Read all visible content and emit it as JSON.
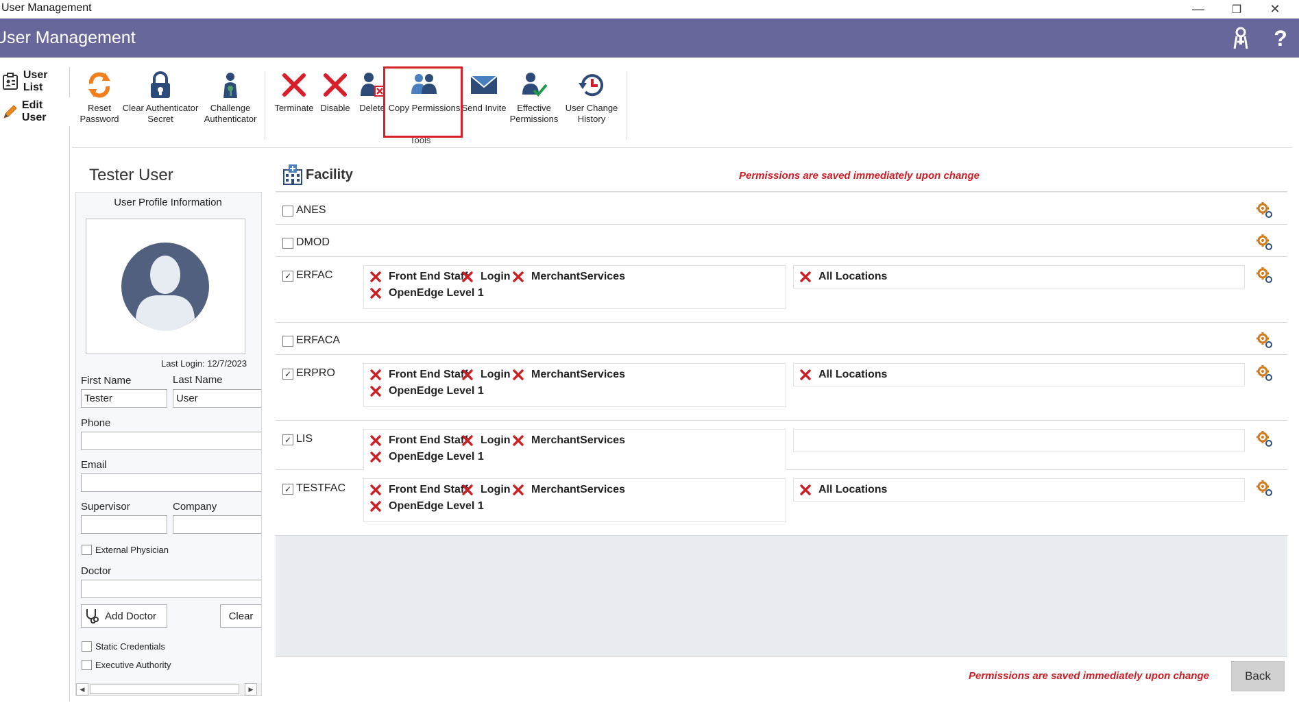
{
  "window": {
    "title": "User Management",
    "minimize_glyph": "—",
    "restore_glyph": "❐",
    "close_glyph": "✕"
  },
  "header": {
    "title": "User Management",
    "help_glyph": "?",
    "background": "#68679b"
  },
  "leftnav": {
    "items": [
      {
        "label": "User List",
        "icon": "user-list-icon"
      },
      {
        "label": "Edit User",
        "icon": "pencil-icon"
      }
    ]
  },
  "toolbar": {
    "group_label": "Tools",
    "buttons": [
      {
        "label": "Reset Password",
        "icon": "refresh-icon"
      },
      {
        "label": "Clear Authenticator Secret",
        "icon": "padlock-icon"
      },
      {
        "label": "Challenge Authenticator",
        "icon": "key-person-icon"
      },
      {
        "label": "Terminate",
        "icon": "red-x-icon"
      },
      {
        "label": "Disable",
        "icon": "red-x-icon"
      },
      {
        "label": "Delete",
        "icon": "user-delete-icon"
      },
      {
        "label": "Copy Permissions",
        "icon": "two-users-icon"
      },
      {
        "label": "Send Invite",
        "icon": "envelope-icon"
      },
      {
        "label": "Effective Permissions",
        "icon": "user-check-icon"
      },
      {
        "label": "User Change History",
        "icon": "history-clock-icon"
      }
    ]
  },
  "profile": {
    "display_name": "Tester User",
    "section_title": "User Profile Information",
    "last_login": "Last Login: 12/7/2023",
    "first_name_label": "First Name",
    "first_name": "Tester",
    "last_name_label": "Last Name",
    "last_name": "User",
    "phone_label": "Phone",
    "phone": "",
    "email_label": "Email",
    "email": "",
    "supervisor_label": "Supervisor",
    "supervisor": "",
    "company_label": "Company",
    "company": "",
    "external_physician_label": "External Physician",
    "doctor_label": "Doctor",
    "doctor": "",
    "add_doctor_label": "Add Doctor",
    "clear_label": "Clear",
    "static_credentials_label": "Static Credentials",
    "executive_authority_label": "Executive Authority"
  },
  "facility": {
    "title": "Facility",
    "notice": "Permissions are saved immediately upon change",
    "rows": [
      {
        "name": "ANES",
        "checked": false,
        "permissions": [],
        "locations": []
      },
      {
        "name": "DMOD",
        "checked": false,
        "permissions": [],
        "locations": []
      },
      {
        "name": "ERFAC",
        "checked": true,
        "permissions": [
          "Front End Staff",
          "Login",
          "MerchantServices",
          "OpenEdge Level 1"
        ],
        "locations": [
          "All Locations"
        ]
      },
      {
        "name": "ERFACA",
        "checked": false,
        "permissions": [],
        "locations": []
      },
      {
        "name": "ERPRO",
        "checked": true,
        "permissions": [
          "Front End Staff",
          "Login",
          "MerchantServices",
          "OpenEdge Level 1"
        ],
        "locations": [
          "All Locations"
        ]
      },
      {
        "name": "LIS",
        "checked": true,
        "permissions": [
          "Front End Staff",
          "Login",
          "MerchantServices",
          "OpenEdge Level 1"
        ],
        "locations": []
      },
      {
        "name": "TESTFAC",
        "checked": true,
        "permissions": [
          "Front End Staff",
          "Login",
          "MerchantServices",
          "OpenEdge Level 1"
        ],
        "locations": [
          "All Locations"
        ]
      }
    ]
  },
  "footer": {
    "notice": "Permissions are saved immediately upon change",
    "back_label": "Back"
  },
  "colors": {
    "accent_red": "#cc1e24",
    "highlight_border": "#d81e2a",
    "panel_bg": "#e9edf2"
  }
}
